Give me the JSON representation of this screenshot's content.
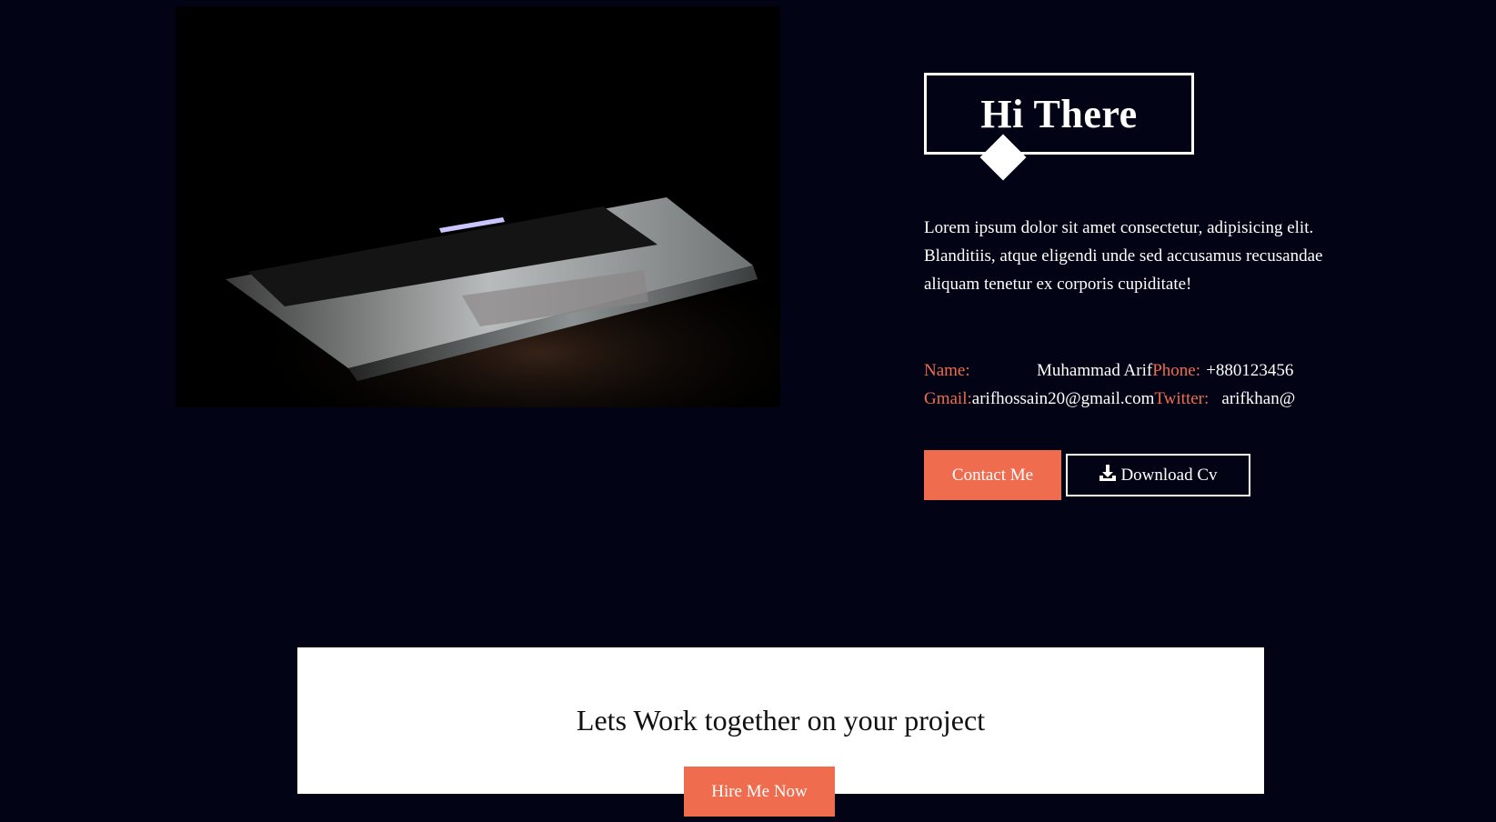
{
  "hero_image": {
    "alt_icon": "laptop-photo"
  },
  "about": {
    "title": "Hi There",
    "intro": "Lorem ipsum dolor sit amet consectetur, adipisicing elit. Blanditiis, atque eligendi unde sed accusamus recusandae aliquam tenetur ex corporis cupiditate!",
    "info": {
      "name_label": "Name:",
      "name_value": "Muhammad Arif",
      "phone_label": "Phone:",
      "phone_value": "+880123456",
      "gmail_label": "Gmail:",
      "gmail_value": "arifhossain20@gmail.com",
      "twitter_label": "Twitter:",
      "twitter_value": "arifkhan@"
    },
    "buttons": {
      "contact_label": "Contact Me",
      "download_label": "Download Cv",
      "download_icon": "download-icon"
    }
  },
  "cta": {
    "text": "Lets Work together on your project",
    "button_label": "Hire Me Now"
  },
  "colors": {
    "background": "#020416",
    "accent": "#f06c4f",
    "text": "#ffffff"
  }
}
